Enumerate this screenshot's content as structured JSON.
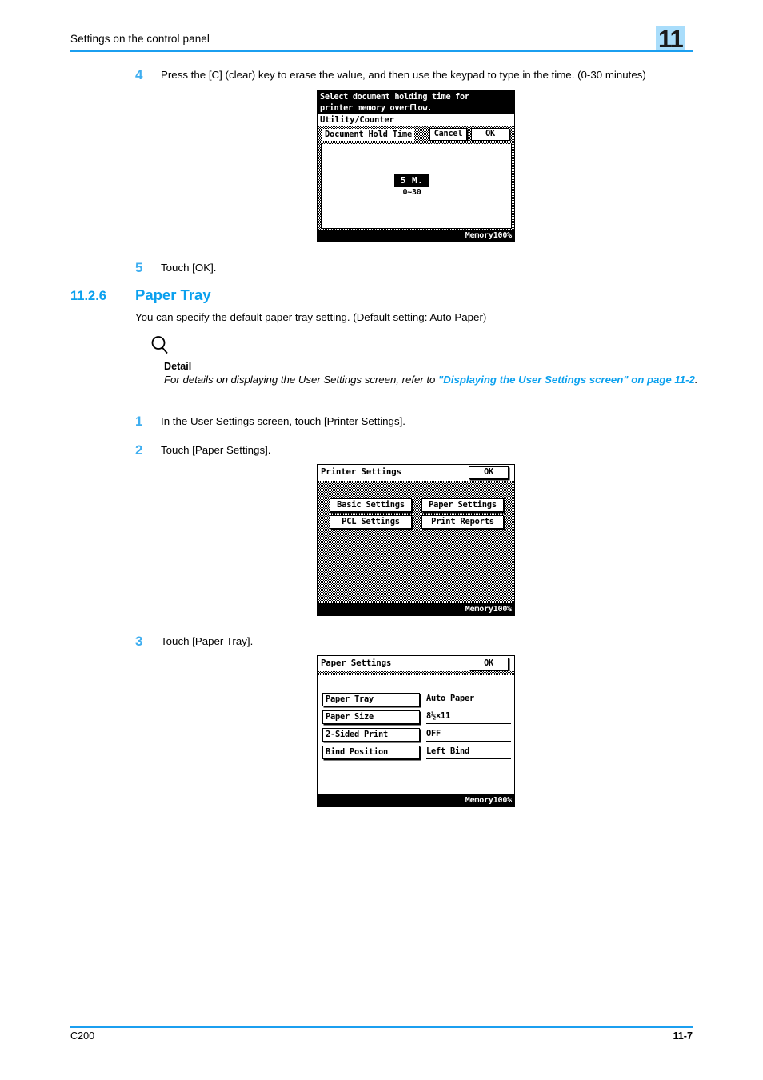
{
  "header": {
    "title": "Settings on the control panel",
    "chapter_badge": "11",
    "rule_color": "#1b9ff0",
    "badge_color": "#a9ddfb"
  },
  "steps": {
    "step4": {
      "number": "4",
      "text": "Press the [C] (clear) key to erase the value, and then use the keypad to type in the time. (0-30 minutes)"
    },
    "step5": {
      "number": "5",
      "text": "Touch [OK]."
    },
    "step1": {
      "number": "1",
      "text": "In the User Settings screen, touch [Printer Settings]."
    },
    "step2": {
      "number": "2",
      "text": "Touch [Paper Settings]."
    },
    "step3": {
      "number": "3",
      "text": "Touch [Paper Tray]."
    }
  },
  "section": {
    "number": "11.2.6",
    "title": "Paper Tray",
    "intro": "You can specify the default paper tray setting. (Default setting: Auto Paper)",
    "heading_color": "#0aa0ee"
  },
  "detail": {
    "icon": "magnifier-icon",
    "label": "Detail",
    "body_before": "For details on displaying the User Settings screen, refer to ",
    "link": "\"Displaying the User Settings screen\" on page 11-2",
    "body_after": ".",
    "link_color": "#0aa0ee"
  },
  "screen1": {
    "message_line1": "Select document holding time for",
    "message_line2": "printer memory overflow.",
    "mode_label": "Utility/Counter",
    "panel_title": "Document Hold Time",
    "cancel_label": "Cancel",
    "ok_label": "OK",
    "value": "5 M.",
    "range": "0~30",
    "status": "Memory100%"
  },
  "screen2": {
    "title": "Printer Settings",
    "ok_label": "OK",
    "buttons": [
      {
        "label": "Basic Settings"
      },
      {
        "label": "Paper Settings"
      },
      {
        "label": "PCL Settings"
      },
      {
        "label": "Print Reports"
      }
    ],
    "status": "Memory100%"
  },
  "screen3": {
    "title": "Paper Settings",
    "ok_label": "OK",
    "rows": [
      {
        "key": "Paper Tray",
        "value": "Auto Paper"
      },
      {
        "key": "Paper Size",
        "value": "8½×11"
      },
      {
        "key": "2-Sided Print",
        "value": "OFF"
      },
      {
        "key": "Bind Position",
        "value": "Left Bind"
      }
    ],
    "status": "Memory100%"
  },
  "footer": {
    "left": "C200",
    "right": "11-7"
  }
}
